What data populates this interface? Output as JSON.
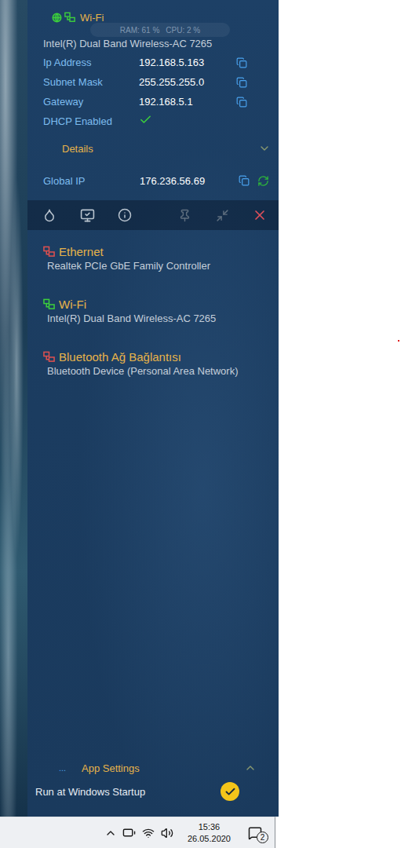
{
  "status_overlay": {
    "ram": "RAM: 61 %",
    "cpu": "CPU: 2 %"
  },
  "active_adapter": {
    "name": "Wi-Fi",
    "device": "Intel(R) Dual Band Wireless-AC 7265",
    "connected": true
  },
  "details_rows": [
    {
      "label": "Ip Address",
      "value": "192.168.5.163",
      "kind": "copy",
      "checked": false
    },
    {
      "label": "Subnet Mask",
      "value": "255.255.255.0",
      "kind": "copy",
      "checked": false
    },
    {
      "label": "Gateway",
      "value": "192.168.5.1",
      "kind": "copy",
      "checked": false
    },
    {
      "label": "DHCP Enabled",
      "value": "",
      "kind": "check",
      "checked": true
    }
  ],
  "details_toggle": {
    "label": "Details",
    "expanded": false
  },
  "global_ip": {
    "label": "Global IP",
    "value": "176.236.56.69"
  },
  "adapters": [
    {
      "name": "Ethernet",
      "device": "Realtek PCIe GbE Family Controller",
      "connected": false,
      "color": "#e0504f"
    },
    {
      "name": "Wi-Fi",
      "device": "Intel(R) Dual Band Wireless-AC 7265",
      "connected": true,
      "color": "#3ccf3c"
    },
    {
      "name": "Bluetooth Ağ Bağlantısı",
      "device": "Bluetooth Device (Personal Area Network)",
      "connected": false,
      "color": "#e0504f"
    }
  ],
  "settings": {
    "more": "...",
    "label": "App Settings",
    "expanded": true,
    "items": [
      {
        "label": "Run at Windows Startup",
        "checked": true
      }
    ]
  },
  "taskbar": {
    "time": "15:36",
    "date": "26.05.2020",
    "notifications": "2"
  }
}
